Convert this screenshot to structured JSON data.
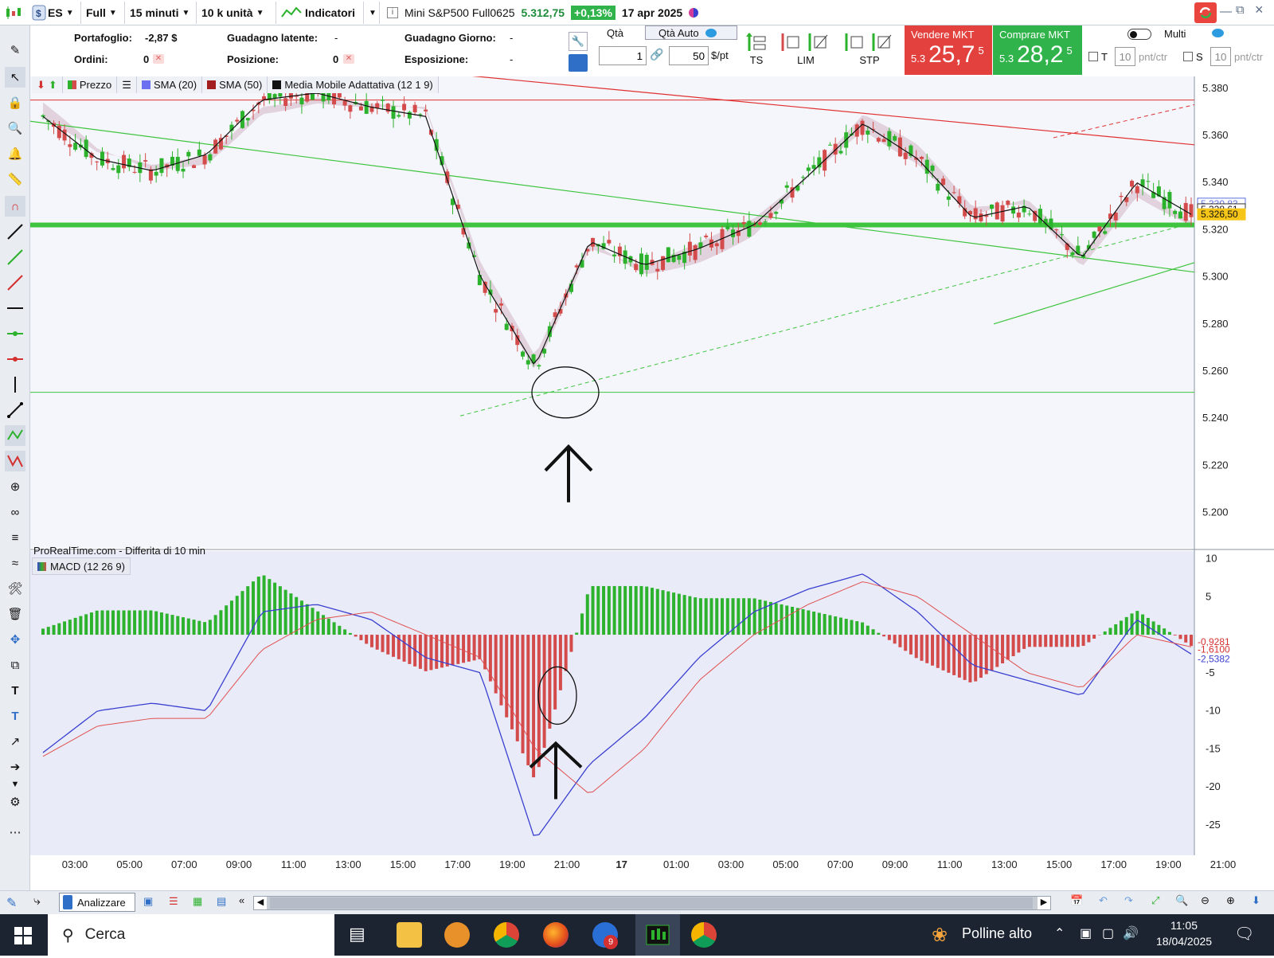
{
  "topbar": {
    "symbol": "ES",
    "mode": "Full",
    "timeframe": "15 minuti",
    "units": "10 k unità",
    "indicators_label": "Indicatori",
    "instrument": "Mini S&P500 Full0625",
    "last_price": "5.312,75",
    "change": "+0,13%",
    "date": "17 apr 2025"
  },
  "account": {
    "portafoglio_label": "Portafoglio:",
    "portafoglio_value": "-2,87 $",
    "ordini_label": "Ordini:",
    "ordini_value": "0",
    "guadagno_latente_label": "Guadagno latente:",
    "guadagno_latente_value": "-",
    "posizione_label": "Posizione:",
    "posizione_value": "0",
    "guadagno_giorno_label": "Guadagno Giorno:",
    "guadagno_giorno_value": "-",
    "esposizione_label": "Esposizione:",
    "esposizione_value": "-"
  },
  "order": {
    "qta_label": "Qtà",
    "qta_auto_label": "Qtà Auto",
    "qty": "1",
    "point_value": "50",
    "point_unit": "$/pt",
    "ts_label": "TS",
    "lim_label": "LIM",
    "stp_label": "STP",
    "sell_label": "Vendere MKT",
    "sell_prefix": "5.3",
    "sell_main": "25,7",
    "sell_sup": "5",
    "buy_label": "Comprare MKT",
    "buy_prefix": "5.3",
    "buy_main": "28,2",
    "buy_sup": "5",
    "multi_label": "Multi",
    "t_label": "T",
    "t_value": "10",
    "s_label": "S",
    "s_value": "10",
    "unit_pntctr": "pnt/ctr"
  },
  "legend": {
    "price": "Prezzo",
    "sma20": "SMA (20)",
    "sma50": "SMA (50)",
    "ama": "Media Mobile Adattativa (12 1 9)",
    "macd": "MACD (12 26 9)",
    "source": "ProRealTime.com - Differita di 10 min"
  },
  "price_axis": {
    "ticks": [
      "5.380",
      "5.360",
      "5.340",
      "5.320",
      "5.300",
      "5.280",
      "5.260",
      "5.240",
      "5.220",
      "5.200"
    ],
    "tick_values": [
      5380,
      5360,
      5340,
      5320,
      5300,
      5280,
      5260,
      5240,
      5220,
      5200
    ],
    "badges": [
      "5.330,83",
      "5.328,61",
      "5.326,50"
    ]
  },
  "macd_axis": {
    "ticks": [
      "10",
      "5",
      "-5",
      "-10",
      "-15",
      "-20",
      "-25"
    ],
    "tick_values": [
      10,
      5,
      -5,
      -10,
      -15,
      -20,
      -25
    ],
    "badges": [
      "-0,9281",
      "-1,6100",
      "-2,5382"
    ]
  },
  "time_axis": {
    "labels": [
      "03:00",
      "05:00",
      "07:00",
      "09:00",
      "11:00",
      "13:00",
      "15:00",
      "17:00",
      "19:00",
      "21:00",
      "17",
      "01:00",
      "03:00",
      "05:00",
      "07:00",
      "09:00",
      "11:00",
      "13:00",
      "15:00",
      "17:00",
      "19:00",
      "21:00"
    ]
  },
  "colors": {
    "up": "#2db22d",
    "down": "#d44b4b",
    "support": "#3fc43f",
    "sell": "#e2413d",
    "buy": "#2fb34a",
    "macd_line": "#3a3fd0",
    "signal_line": "#e05050"
  },
  "bottombar": {
    "analyzer_label": "Analizzare"
  },
  "taskbar": {
    "search_label": "Cerca",
    "weather": "Polline alto",
    "time": "11:05",
    "date": "18/04/2025",
    "badge": "9"
  },
  "chart_data": [
    {
      "type": "line",
      "title": "Mini S&P500 Full0625",
      "ylim": [
        5185,
        5385
      ],
      "x": [
        "03:00",
        "05:00",
        "07:00",
        "09:00",
        "11:00",
        "13:00",
        "15:00",
        "17:00",
        "19:00",
        "21:00",
        "17",
        "01:00",
        "03:00",
        "05:00",
        "07:00",
        "09:00",
        "11:00",
        "13:00",
        "15:00",
        "17:00",
        "19:00",
        "21:00"
      ],
      "series": [
        {
          "name": "Prezzo",
          "values": [
            5368,
            5350,
            5345,
            5352,
            5375,
            5378,
            5372,
            5368,
            5300,
            5262,
            5315,
            5305,
            5312,
            5322,
            5343,
            5365,
            5350,
            5325,
            5330,
            5308,
            5340,
            5326.5
          ]
        }
      ]
    },
    {
      "type": "bar",
      "title": "MACD (12 26 9)",
      "ylim": [
        -29,
        11
      ],
      "x": [
        "03:00",
        "05:00",
        "07:00",
        "09:00",
        "11:00",
        "13:00",
        "15:00",
        "17:00",
        "19:00",
        "21:00",
        "17",
        "01:00",
        "03:00",
        "05:00",
        "07:00",
        "09:00",
        "11:00",
        "13:00",
        "15:00",
        "17:00",
        "19:00",
        "21:00"
      ],
      "series": [
        {
          "name": "MACD",
          "values": [
            -15.5,
            -10,
            -9,
            -10,
            3,
            4,
            2,
            -3,
            -5,
            -27,
            -17,
            -11,
            -3,
            3,
            6,
            8,
            3,
            -4,
            -6,
            -8,
            2,
            -2.5382
          ]
        },
        {
          "name": "Signal",
          "values": [
            -16,
            -12,
            -11,
            -11,
            -2,
            2,
            3,
            0,
            -3,
            -15,
            -21,
            -15,
            -6,
            0,
            4,
            7,
            5,
            0,
            -5,
            -7,
            0,
            -1.61
          ]
        }
      ]
    }
  ]
}
